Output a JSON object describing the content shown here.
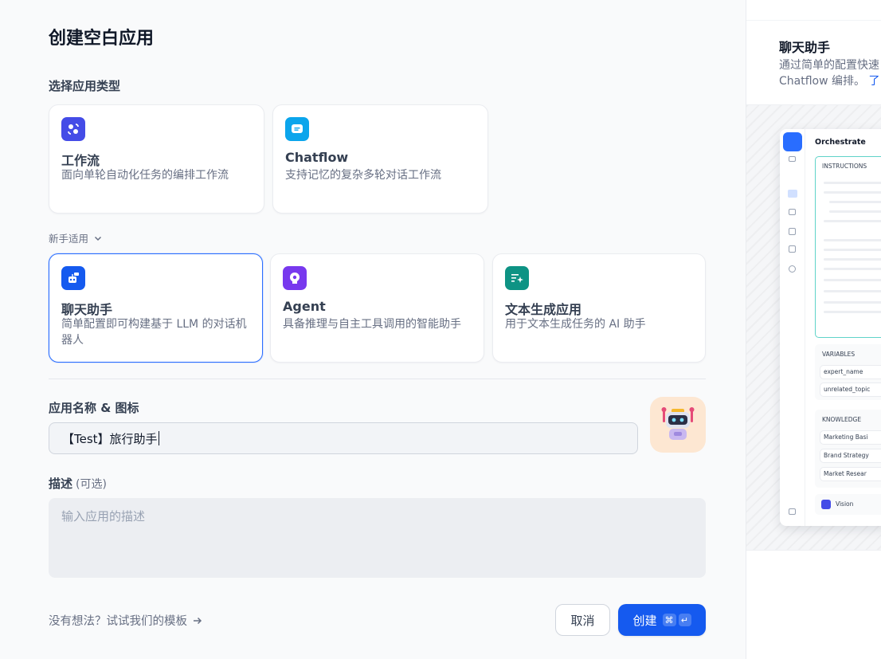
{
  "title": "创建空白应用",
  "select_type_label": "选择应用类型",
  "cards_top": [
    {
      "title": "工作流",
      "desc": "面向单轮自动化任务的编排工作流",
      "icon": "workflow-icon",
      "color": "#444ce7"
    },
    {
      "title": "Chatflow",
      "desc": "支持记忆的复杂多轮对话工作流",
      "icon": "chatflow-icon",
      "color": "#0ba5ec"
    }
  ],
  "beginner_label": "新手适用",
  "cards_beginner": [
    {
      "title": "聊天助手",
      "desc": "简单配置即可构建基于 LLM 的对话机器人",
      "icon": "chatbot-icon",
      "color": "#155aef"
    },
    {
      "title": "Agent",
      "desc": "具备推理与自主工具调用的智能助手",
      "icon": "agent-icon",
      "color": "#7839ee"
    },
    {
      "title": "文本生成应用",
      "desc": "用于文本生成任务的 AI 助手",
      "icon": "text-generator-icon",
      "color": "#0e9384"
    }
  ],
  "name_label": "应用名称 & 图标",
  "name_value": "【Test】旅行助手",
  "desc_label": "描述",
  "desc_optional": "(可选)",
  "desc_placeholder": "输入应用的描述",
  "template_link": "没有想法？试试我们的模板",
  "cancel_label": "取消",
  "create_label": "创建",
  "create_kbd1": "⌘",
  "create_kbd2": "↵",
  "preview": {
    "title": "聊天助手",
    "desc_line1": "通过简单的配置快速",
    "desc_line2": "Chatflow 编排。",
    "link": "了",
    "orchestrate": "Orchestrate",
    "instructions": "INSTRUCTIONS",
    "variables": "VARIABLES",
    "var1": "expert_name",
    "var2": "unrelated_topic",
    "knowledge": "KNOWLEDGE",
    "k1": "Marketing Basi",
    "k2": "Brand Strategy",
    "k3": "Market Resear",
    "vision": "Vision"
  }
}
